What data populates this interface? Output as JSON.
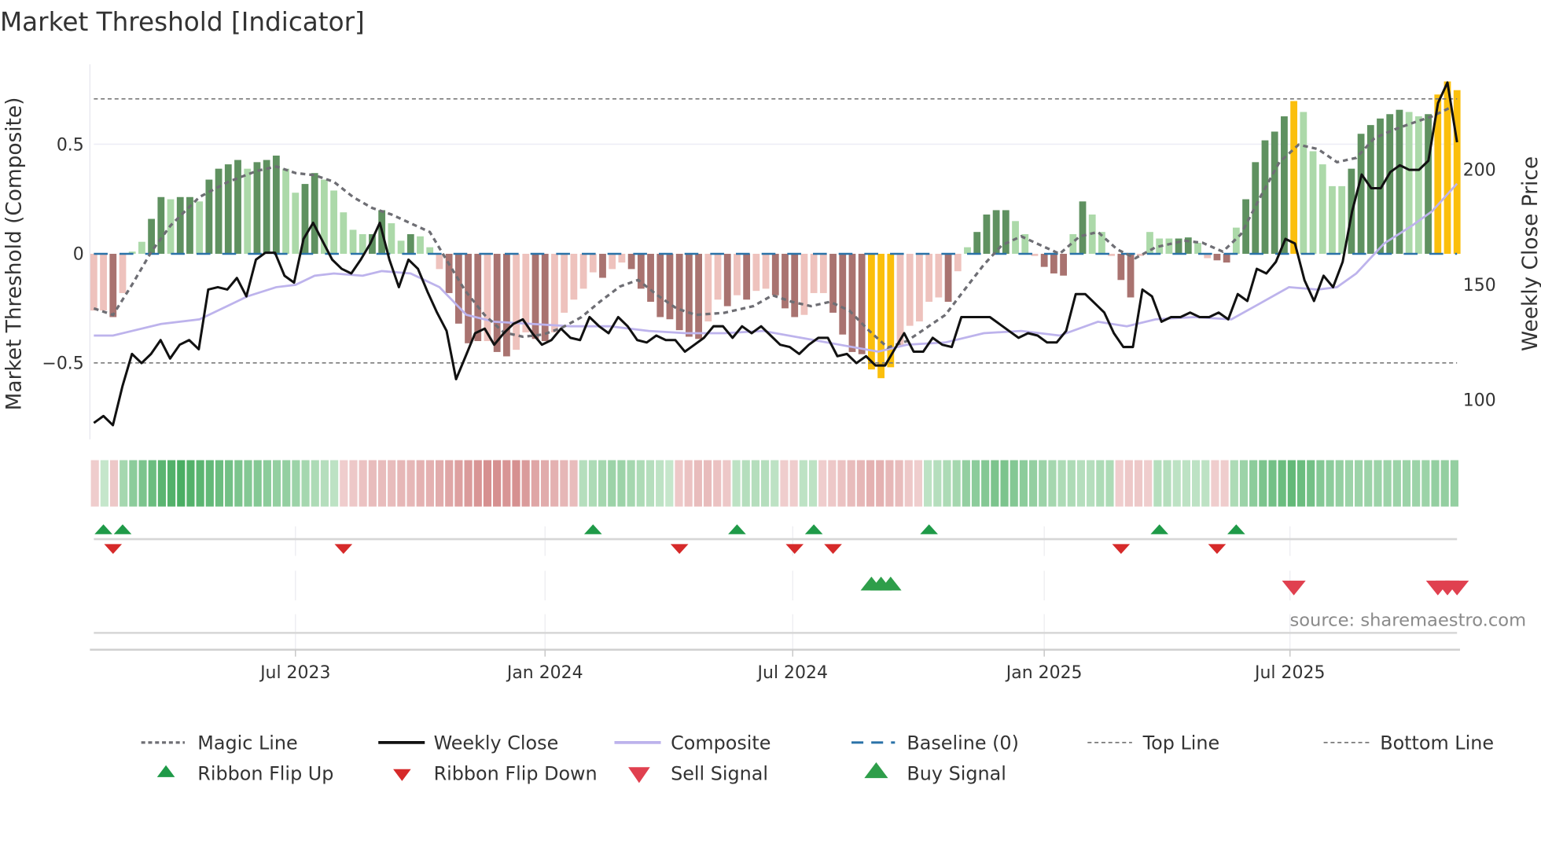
{
  "title": "Market Threshold [Indicator]",
  "source": "source: sharemaestro.com",
  "colors": {
    "dark_green": "#5f9160",
    "light_green": "#acd9a9",
    "dark_red": "#a97370",
    "light_red": "#eec2bd",
    "gold": "#fbbf0c",
    "magic": "#6e6e74",
    "close": "#111111",
    "composite": "#bdb3ec",
    "baseline": "#2a72a8",
    "flip_up": "#1f9a48",
    "flip_down": "#d62a2a",
    "buy": "#2e9e4a",
    "sell": "#e0404f"
  },
  "legend": {
    "magic_line": "Magic Line",
    "weekly_close": "Weekly Close",
    "composite": "Composite",
    "baseline": "Baseline (0)",
    "top_line": "Top Line",
    "bottom_line": "Bottom Line",
    "ribbon_flip_up": "Ribbon Flip Up",
    "ribbon_flip_down": "Ribbon Flip Down",
    "sell_signal": "Sell Signal",
    "buy_signal": "Buy Signal"
  },
  "chart_data": {
    "type": "bar",
    "title": "Market Threshold [Indicator]",
    "ylabel": "Market Threshold (Composite)",
    "y2label": "Weekly Close Price",
    "x_unit": "week index (weekly bars, ~Feb 2023 to ~Oct 2025)",
    "ylim": [
      -0.86,
      0.87
    ],
    "y2lim": [
      90,
      240
    ],
    "yticks": [
      {
        "v": 0.5,
        "label": "0.5"
      },
      {
        "v": 0,
        "label": "0"
      },
      {
        "v": -0.5,
        "label": "−0.5"
      }
    ],
    "y2ticks": [
      {
        "v": 200,
        "label": "200"
      },
      {
        "v": 150,
        "label": "150"
      },
      {
        "v": 100,
        "label": "100"
      }
    ],
    "xticks": [
      {
        "week": 21,
        "label": "Jul 2023"
      },
      {
        "week": 47,
        "label": "Jan 2024"
      },
      {
        "week": 72.8,
        "label": "Jul 2024"
      },
      {
        "week": 99,
        "label": "Jan 2025"
      },
      {
        "week": 124.6,
        "label": "Jul 2025"
      }
    ],
    "top_line": 0.71,
    "bottom_line": -0.5,
    "baseline": 0,
    "composite_bars": {
      "values": [
        -0.26,
        -0.26,
        -0.29,
        -0.18,
        0.01,
        0.055,
        0.16,
        0.26,
        0.25,
        0.26,
        0.26,
        0.24,
        0.34,
        0.39,
        0.41,
        0.43,
        0.39,
        0.42,
        0.43,
        0.45,
        0.39,
        0.28,
        0.32,
        0.37,
        0.34,
        0.29,
        0.19,
        0.11,
        0.09,
        0.09,
        0.2,
        0.14,
        0.06,
        0.09,
        0.08,
        0.03,
        -0.07,
        -0.18,
        -0.32,
        -0.41,
        -0.4,
        -0.4,
        -0.45,
        -0.47,
        -0.44,
        -0.36,
        -0.39,
        -0.4,
        -0.36,
        -0.27,
        -0.21,
        -0.16,
        -0.085,
        -0.11,
        -0.07,
        -0.04,
        -0.07,
        -0.16,
        -0.22,
        -0.29,
        -0.3,
        -0.35,
        -0.38,
        -0.39,
        -0.31,
        -0.21,
        -0.24,
        -0.19,
        -0.21,
        -0.17,
        -0.16,
        -0.19,
        -0.25,
        -0.29,
        -0.28,
        -0.18,
        -0.18,
        -0.27,
        -0.37,
        -0.45,
        -0.46,
        -0.53,
        -0.57,
        -0.52,
        -0.42,
        -0.33,
        -0.31,
        -0.22,
        -0.2,
        -0.22,
        -0.08,
        0.03,
        0.1,
        0.18,
        0.2,
        0.2,
        0.15,
        0.09,
        -0.01,
        -0.06,
        -0.09,
        -0.1,
        0.09,
        0.24,
        0.18,
        0.1,
        -0.01,
        -0.12,
        -0.2,
        -0.01,
        0.1,
        0.07,
        0.07,
        0.07,
        0.075,
        0.05,
        -0.02,
        -0.03,
        -0.04,
        0.12,
        0.25,
        0.42,
        0.52,
        0.56,
        0.63,
        0.7,
        0.65,
        0.47,
        0.41,
        0.31,
        0.31,
        0.39,
        0.55,
        0.59,
        0.62,
        0.64,
        0.66,
        0.65,
        0.63,
        0.64,
        0.73,
        0.79,
        0.75
      ],
      "states": [
        "lr",
        "lr",
        "dr",
        "lr",
        "lg",
        "lg",
        "dg",
        "dg",
        "lg",
        "dg",
        "dg",
        "lg",
        "dg",
        "dg",
        "dg",
        "dg",
        "lg",
        "dg",
        "dg",
        "dg",
        "lg",
        "lg",
        "dg",
        "dg",
        "lg",
        "lg",
        "lg",
        "lg",
        "lg",
        "dg",
        "dg",
        "lg",
        "lg",
        "dg",
        "lg",
        "lg",
        "lr",
        "dr",
        "dr",
        "dr",
        "dr",
        "lr",
        "dr",
        "dr",
        "lr",
        "lr",
        "dr",
        "dr",
        "lr",
        "lr",
        "lr",
        "lr",
        "lr",
        "dr",
        "lr",
        "lr",
        "dr",
        "dr",
        "dr",
        "dr",
        "dr",
        "dr",
        "dr",
        "dr",
        "lr",
        "lr",
        "dr",
        "lr",
        "dr",
        "lr",
        "lr",
        "dr",
        "dr",
        "dr",
        "lr",
        "lr",
        "lr",
        "dr",
        "dr",
        "dr",
        "dr",
        "y",
        "y",
        "y",
        "lr",
        "lr",
        "lr",
        "lr",
        "lr",
        "dr",
        "lr",
        "lg",
        "dg",
        "dg",
        "dg",
        "dg",
        "lg",
        "lg",
        "lr",
        "dr",
        "dr",
        "dr",
        "lg",
        "dg",
        "lg",
        "lg",
        "lr",
        "dr",
        "dr",
        "lr",
        "lg",
        "lg",
        "lg",
        "dg",
        "dg",
        "lg",
        "lr",
        "dr",
        "dr",
        "lg",
        "dg",
        "dg",
        "dg",
        "dg",
        "dg",
        "y",
        "lg",
        "lg",
        "lg",
        "lg",
        "lg",
        "dg",
        "dg",
        "dg",
        "dg",
        "dg",
        "dg",
        "lg",
        "lg",
        "dg",
        "y",
        "y",
        "y"
      ]
    },
    "weekly_close": [
      90,
      93,
      89,
      106,
      120,
      116,
      120,
      126,
      118,
      124,
      126,
      122,
      148,
      149,
      148,
      153,
      145,
      161,
      164,
      164,
      154,
      151,
      170,
      177,
      169,
      161,
      157,
      155,
      161,
      168,
      177,
      161,
      149,
      161,
      157,
      147,
      138,
      130,
      109,
      119,
      129,
      131,
      124,
      129,
      133,
      135,
      129,
      124,
      126,
      131,
      127,
      126,
      136,
      132,
      129,
      136,
      132,
      126,
      125,
      128,
      126,
      126,
      121,
      124,
      127,
      132,
      132,
      127,
      132,
      129,
      132,
      128,
      124,
      123,
      120,
      124,
      127,
      127,
      119,
      120,
      116,
      119,
      115,
      115,
      122,
      129,
      121,
      121,
      127,
      124,
      123,
      136,
      136,
      136,
      136,
      133,
      130,
      127,
      129,
      128,
      125,
      125,
      130,
      146,
      146,
      142,
      138,
      129,
      123,
      123,
      148,
      145,
      134,
      136,
      136,
      138,
      136,
      136,
      138,
      135,
      146,
      143,
      157,
      155,
      160,
      170,
      168,
      152,
      143,
      154,
      149,
      160,
      182,
      198,
      192,
      192,
      199,
      202,
      200,
      200,
      204,
      229,
      238,
      212
    ],
    "composite_line": [
      [
        0,
        128
      ],
      [
        2,
        128
      ],
      [
        4,
        130
      ],
      [
        7,
        133
      ],
      [
        11,
        135
      ],
      [
        14,
        141
      ],
      [
        16,
        145
      ],
      [
        19,
        149
      ],
      [
        21,
        150
      ],
      [
        23,
        154
      ],
      [
        25,
        155
      ],
      [
        28,
        154
      ],
      [
        30,
        156
      ],
      [
        33,
        155
      ],
      [
        36,
        149
      ],
      [
        38.8,
        137
      ],
      [
        41.7,
        134
      ],
      [
        45.7,
        133
      ],
      [
        49.7,
        132
      ],
      [
        53.7,
        132
      ],
      [
        57.8,
        130
      ],
      [
        61.7,
        129
      ],
      [
        65.7,
        129
      ],
      [
        69.7,
        130
      ],
      [
        73.7,
        127
      ],
      [
        77.7,
        124
      ],
      [
        81.7,
        121
      ],
      [
        84.7,
        124
      ],
      [
        88.7,
        125
      ],
      [
        92.7,
        129
      ],
      [
        96.6,
        130
      ],
      [
        100.6,
        128
      ],
      [
        104.6,
        134
      ],
      [
        107.6,
        132
      ],
      [
        110.6,
        135
      ],
      [
        114.6,
        136
      ],
      [
        118.5,
        135
      ],
      [
        121.5,
        142
      ],
      [
        124.5,
        149
      ],
      [
        127.5,
        148
      ],
      [
        129.5,
        149
      ],
      [
        131.5,
        155
      ],
      [
        134.4,
        168
      ],
      [
        137.4,
        176
      ],
      [
        139.4,
        182
      ],
      [
        142,
        194
      ]
    ],
    "magic_line": [
      [
        0,
        -0.25
      ],
      [
        2,
        -0.28
      ],
      [
        4,
        -0.14
      ],
      [
        6,
        0.01
      ],
      [
        8,
        0.13
      ],
      [
        11,
        0.26
      ],
      [
        14,
        0.33
      ],
      [
        17,
        0.38
      ],
      [
        19,
        0.4
      ],
      [
        21,
        0.37
      ],
      [
        23,
        0.36
      ],
      [
        25,
        0.33
      ],
      [
        27,
        0.26
      ],
      [
        29,
        0.21
      ],
      [
        31,
        0.18
      ],
      [
        33,
        0.14
      ],
      [
        35,
        0.1
      ],
      [
        36.9,
        -0.04
      ],
      [
        38.7,
        -0.17
      ],
      [
        40.7,
        -0.28
      ],
      [
        42.7,
        -0.36
      ],
      [
        44.7,
        -0.38
      ],
      [
        46.8,
        -0.37
      ],
      [
        48.7,
        -0.34
      ],
      [
        50.8,
        -0.29
      ],
      [
        52.7,
        -0.22
      ],
      [
        54.8,
        -0.15
      ],
      [
        56.7,
        -0.12
      ],
      [
        58.7,
        -0.19
      ],
      [
        60.7,
        -0.25
      ],
      [
        62.7,
        -0.28
      ],
      [
        65.7,
        -0.27
      ],
      [
        68.7,
        -0.24
      ],
      [
        70.7,
        -0.19
      ],
      [
        72.7,
        -0.22
      ],
      [
        74.7,
        -0.24
      ],
      [
        76.7,
        -0.22
      ],
      [
        78.7,
        -0.26
      ],
      [
        80.7,
        -0.35
      ],
      [
        82.7,
        -0.43
      ],
      [
        84.7,
        -0.4
      ],
      [
        86.7,
        -0.34
      ],
      [
        88.7,
        -0.28
      ],
      [
        90.6,
        -0.17
      ],
      [
        92.7,
        -0.05
      ],
      [
        94.6,
        0.04
      ],
      [
        96.6,
        0.08
      ],
      [
        98.6,
        0.04
      ],
      [
        100.6,
        0
      ],
      [
        102.7,
        0.08
      ],
      [
        104.6,
        0.1
      ],
      [
        106.6,
        0.02
      ],
      [
        108.5,
        -0.02
      ],
      [
        110.6,
        0.03
      ],
      [
        113.6,
        0.06
      ],
      [
        115.5,
        0.05
      ],
      [
        117.6,
        0.01
      ],
      [
        119.5,
        0.09
      ],
      [
        121.5,
        0.26
      ],
      [
        123.5,
        0.42
      ],
      [
        125.5,
        0.5
      ],
      [
        127.5,
        0.48
      ],
      [
        129.5,
        0.42
      ],
      [
        131.5,
        0.44
      ],
      [
        133.4,
        0.53
      ],
      [
        135.5,
        0.57
      ],
      [
        137.4,
        0.6
      ],
      [
        139.4,
        0.63
      ],
      [
        141.3,
        0.67
      ]
    ],
    "ribbon_strength": [
      -0.15,
      0.15,
      -0.2,
      0.35,
      0.5,
      0.6,
      0.7,
      0.8,
      0.85,
      0.9,
      0.85,
      0.8,
      0.75,
      0.7,
      0.65,
      0.6,
      0.55,
      0.55,
      0.5,
      0.45,
      0.45,
      0.4,
      0.35,
      0.3,
      0.25,
      0.2,
      -0.15,
      -0.2,
      -0.25,
      -0.3,
      -0.3,
      -0.3,
      -0.35,
      -0.35,
      -0.4,
      -0.4,
      -0.45,
      -0.5,
      -0.55,
      -0.6,
      -0.65,
      -0.7,
      -0.7,
      -0.65,
      -0.7,
      -0.6,
      -0.5,
      -0.45,
      -0.4,
      -0.35,
      -0.3,
      0.25,
      0.3,
      0.35,
      0.4,
      0.4,
      0.35,
      0.3,
      0.25,
      0.2,
      0.15,
      -0.2,
      -0.25,
      -0.3,
      -0.3,
      -0.25,
      -0.2,
      0.2,
      0.25,
      0.25,
      0.25,
      0.2,
      -0.15,
      -0.15,
      0.2,
      0.2,
      -0.15,
      -0.2,
      -0.25,
      -0.3,
      -0.35,
      -0.4,
      -0.4,
      -0.35,
      -0.3,
      -0.2,
      -0.15,
      0.2,
      0.25,
      0.3,
      0.35,
      0.45,
      0.5,
      0.55,
      0.6,
      0.6,
      0.55,
      0.5,
      0.45,
      0.4,
      0.35,
      0.3,
      0.3,
      0.25,
      0.25,
      0.3,
      0.3,
      -0.15,
      -0.2,
      -0.2,
      -0.15,
      0.25,
      0.25,
      0.2,
      0.2,
      0.2,
      0.2,
      -0.15,
      -0.15,
      0.3,
      0.4,
      0.5,
      0.6,
      0.65,
      0.7,
      0.75,
      0.7,
      0.65,
      0.55,
      0.5,
      0.45,
      0.4,
      0.4,
      0.4,
      0.4,
      0.4,
      0.4,
      0.4,
      0.4,
      0.4,
      0.45,
      0.45,
      0.45
    ],
    "ribbon_flip_up_weeks": [
      1,
      3,
      52,
      67,
      75,
      87,
      111,
      119
    ],
    "ribbon_flip_down_weeks": [
      2,
      26,
      61,
      73,
      77,
      107,
      117
    ],
    "buy_signal_weeks": [
      81,
      82,
      83
    ],
    "sell_signal_weeks": [
      125,
      140,
      141,
      142
    ]
  }
}
